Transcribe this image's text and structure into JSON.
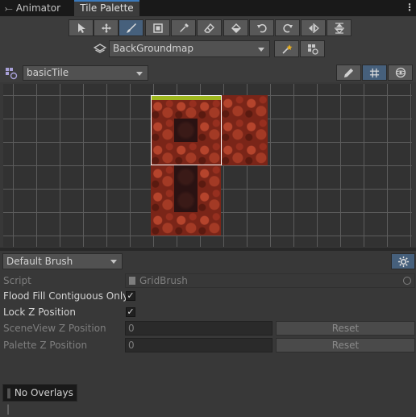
{
  "tabs": {
    "animator": "Animator",
    "animator_icon": "animator-icon",
    "palette": "Tile Palette",
    "more_menu": "⋮"
  },
  "toolbar": {
    "tools": [
      "select-icon",
      "move-icon",
      "paint-brush-icon",
      "box-fill-icon",
      "picker-icon",
      "eraser-icon",
      "fill-bucket-icon",
      "rotate-counterclockwise-icon",
      "rotate-clockwise-icon",
      "flip-x-icon",
      "flip-y-icon"
    ],
    "active_tool": "paint-brush-icon",
    "target": "BackGroundmap"
  },
  "palette": {
    "name": "basicTile"
  },
  "brush": {
    "name": "Default Brush",
    "script_label": "Script",
    "script_value": "GridBrush",
    "flood_fill_label": "Flood Fill Contiguous Only",
    "flood_fill_checked": true,
    "lock_z_label": "Lock Z Position",
    "lock_z_checked": true,
    "sceneview_z_label": "SceneView Z Position",
    "sceneview_z_value": "0",
    "palette_z_label": "Palette Z Position",
    "palette_z_value": "0",
    "reset_label": "Reset"
  },
  "overlays": {
    "label": "No Overlays"
  },
  "colors": {
    "accent": "#3a79bb",
    "active_tool_bg": "#46607c",
    "grass": "#9fb81f",
    "rock": "#7a2518"
  }
}
